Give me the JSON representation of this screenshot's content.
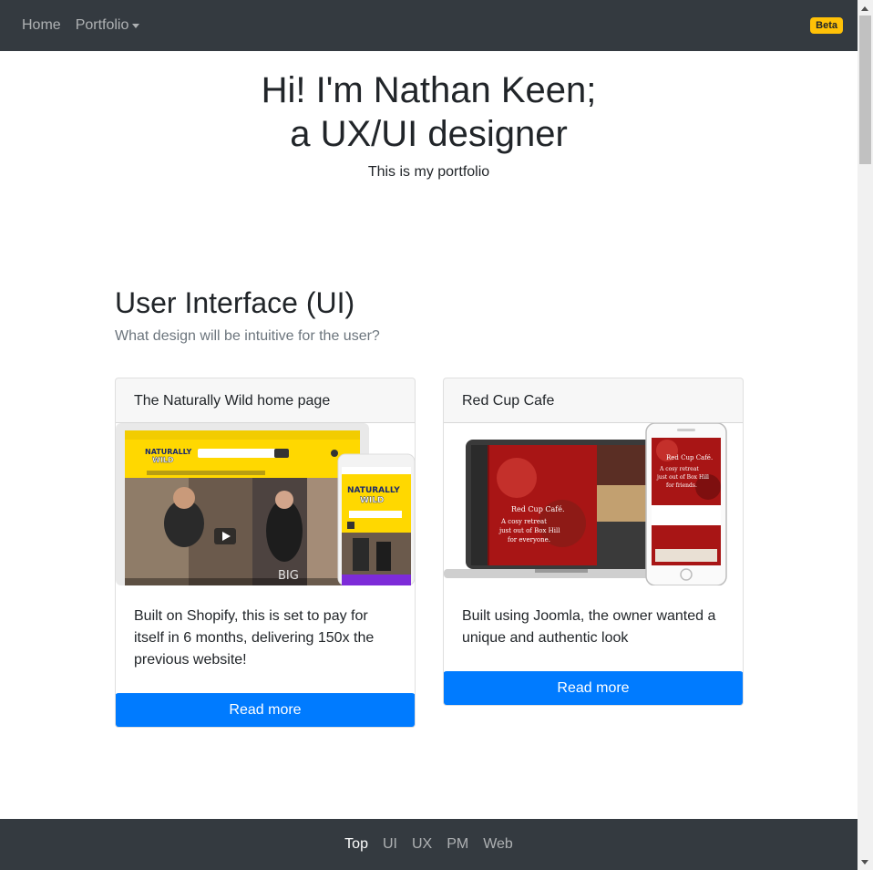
{
  "nav": {
    "home": "Home",
    "portfolio": "Portfolio",
    "badge": "Beta"
  },
  "hero": {
    "title_line1": "Hi! I'm Nathan Keen;",
    "title_line2": "a UX/UI designer",
    "subtitle": "This is my portfolio"
  },
  "section": {
    "title": "User Interface (UI)",
    "subtitle": "What design will be intuitive for the user?"
  },
  "cards": [
    {
      "header": "The Naturally Wild home page",
      "body": "Built on Shopify, this is set to pay for itself in 6 months, delivering 150x the previous website!",
      "button": "Read more",
      "img_logo": "NATURALLY WILD",
      "img_overlay": "BIG"
    },
    {
      "header": "Red Cup Cafe",
      "body": "Built using Joomla, the owner wanted a unique and authentic look",
      "button": "Read more",
      "img_tagline": "Red Cup Café. A cosy retreat just out of Box Hill for everyone.",
      "img_tagline_phone": "Red Cup Café. A cosy retreat just out of Box Hill for friends."
    }
  ],
  "footer": {
    "links": [
      "Top",
      "UI",
      "UX",
      "PM",
      "Web"
    ]
  },
  "colors": {
    "navbar": "#343a40",
    "primary": "#007bff",
    "badge": "#ffc107",
    "muted": "#6c757d"
  }
}
